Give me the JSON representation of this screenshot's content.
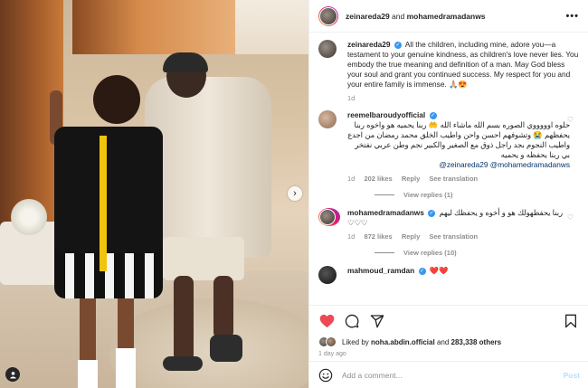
{
  "header": {
    "user1": "zeinareda29",
    "and": "and",
    "user2": "mohamedramadanws"
  },
  "caption": {
    "username": "zeinareda29",
    "text": "All the children, including mine, adore you—a testament to your genuine kindness, as children's love never lies. You embody the true meaning and definition of a man. May God bless your soul and grant you continued success. My respect for you and your entire family is immense. 🙏🏼😍",
    "time": "1d"
  },
  "comments": [
    {
      "username": "reemelbaroudyofficial",
      "text": "حلوه اوووووي الصوره بسم الله ماشاء الله 🤲 ربنا يحميه هو واخوه ربنا يحفظهم 😭 وتشوفهم احسن واحن واطيب الخلق محمد رمضان من اجدع واطيب النجوم بجد راجل ذوق مع الصغير والكبير نجم وطن عربي نفتخر بي ربنا يحفظه و يحميه",
      "mention": "zeinareda29 @mohamedramadanws@",
      "time": "1d",
      "likes": "202 likes",
      "reply": "Reply",
      "translate": "See translation",
      "replies": "View replies (1)"
    },
    {
      "username": "mohamedramadanws",
      "text": "ربنا يحفظهولك هو و أخوه و يحفظك ليهم ♡♡♡",
      "time": "1d",
      "likes": "872 likes",
      "reply": "Reply",
      "translate": "See translation",
      "replies": "View replies (10)"
    },
    {
      "username": "mahmoud_ramdan",
      "text": "❤️❤️"
    }
  ],
  "actions": {
    "liked_prefix": "Liked by",
    "liked_user": "noha.abdin.official",
    "liked_and": "and",
    "liked_count": "283,338 others",
    "posted": "1 day ago"
  },
  "add_comment": {
    "placeholder": "Add a comment...",
    "post": "Post"
  },
  "colors": {
    "like_red": "#ed4956",
    "verified_blue": "#3897f0",
    "post_disabled": "#b2dffc"
  }
}
